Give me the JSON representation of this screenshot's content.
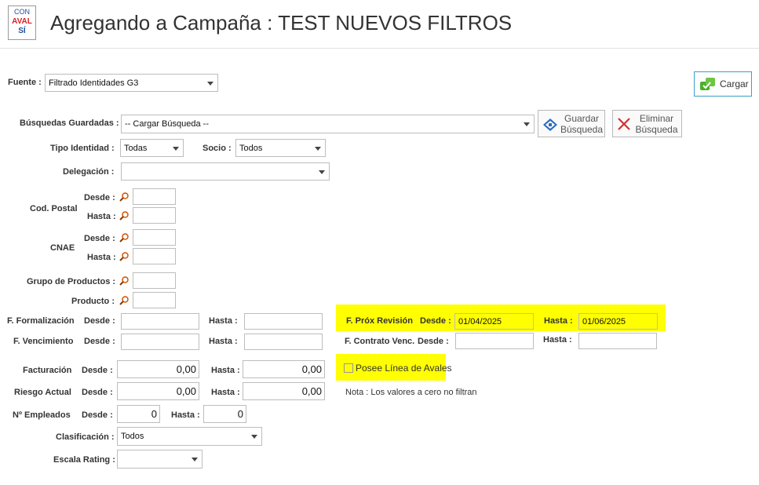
{
  "logo": {
    "line1": "CON",
    "line2": "AVAL",
    "line3": "SÍ"
  },
  "page_title": "Agregando a Campaña : TEST NUEVOS FILTROS",
  "fuente": {
    "label": "Fuente :",
    "value": "Filtrado Identidades G3"
  },
  "cargar_button": "Cargar",
  "busquedas": {
    "label": "Búsquedas Guardadas :",
    "value": "-- Cargar Búsqueda --"
  },
  "guardar_button": {
    "line1": "Guardar",
    "line2": "Búsqueda"
  },
  "eliminar_button": {
    "line1": "Eliminar",
    "line2": "Búsqueda"
  },
  "tipo_identidad": {
    "label": "Tipo Identidad :",
    "value": "Todas"
  },
  "socio": {
    "label": "Socio :",
    "value": "Todos"
  },
  "delegacion": {
    "label": "Delegación :",
    "value": ""
  },
  "cod_postal": {
    "label": "Cod. Postal",
    "desde": "Desde :",
    "hasta": "Hasta :"
  },
  "cnae": {
    "label": "CNAE",
    "desde": "Desde :",
    "hasta": "Hasta :"
  },
  "grupo_productos": {
    "label": "Grupo de Productos :"
  },
  "producto": {
    "label": "Producto :"
  },
  "f_formalizacion": {
    "label": "F. Formalización",
    "desde": "Desde :",
    "hasta": "Hasta :",
    "desde_value": "",
    "hasta_value": ""
  },
  "f_vencimiento": {
    "label": "F. Vencimiento",
    "desde": "Desde :",
    "hasta": "Hasta :",
    "desde_value": "",
    "hasta_value": ""
  },
  "f_prox_revision": {
    "label": "F. Próx Revisión",
    "desde": "Desde :",
    "hasta": "Hasta :",
    "desde_value": "01/04/2025",
    "hasta_value": "01/06/2025"
  },
  "f_contrato_venc": {
    "label": "F. Contrato Venc.",
    "desde": "Desde :",
    "hasta": "Hasta :",
    "desde_value": "",
    "hasta_value": ""
  },
  "facturacion": {
    "label": "Facturación",
    "desde": "Desde :",
    "hasta": "Hasta :",
    "desde_value": "0,00",
    "hasta_value": "0,00"
  },
  "riesgo_actual": {
    "label": "Riesgo Actual",
    "desde": "Desde :",
    "hasta": "Hasta :",
    "desde_value": "0,00",
    "hasta_value": "0,00"
  },
  "n_empleados": {
    "label": "Nº Empleados",
    "desde": "Desde :",
    "hasta": "Hasta :",
    "desde_value": "0",
    "hasta_value": "0"
  },
  "posee_linea_avales": {
    "label": "Posee Línea de Avales",
    "checked": false
  },
  "nota": "Nota : Los valores a cero no filtran",
  "clasificacion": {
    "label": "Clasificación :",
    "value": "Todos"
  },
  "escala_rating": {
    "label": "Escala Rating :",
    "value": ""
  },
  "colors": {
    "highlight": "#ffff00",
    "brand_blue": "#1f4e9c",
    "brand_red": "#d81f26",
    "cargar_green": "#4caf2a"
  }
}
